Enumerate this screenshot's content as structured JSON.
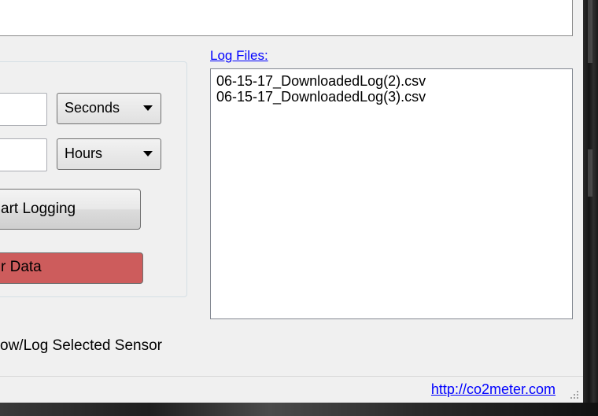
{
  "form": {
    "interval_unit": {
      "selected": "Seconds"
    },
    "duration_unit": {
      "selected": "Hours"
    },
    "start_logging_label": "art Logging",
    "clear_data_label": "r Data",
    "show_log_selected_label": "ow/Log Selected Sensor"
  },
  "log_files": {
    "label": "Log Files:",
    "items": [
      "06-15-17_DownloadedLog(2).csv",
      "06-15-17_DownloadedLog(3).csv"
    ]
  },
  "status_bar": {
    "link": "http://co2meter.com"
  },
  "colors": {
    "clear_button": "#cd5c5c",
    "link": "#0000ff"
  }
}
